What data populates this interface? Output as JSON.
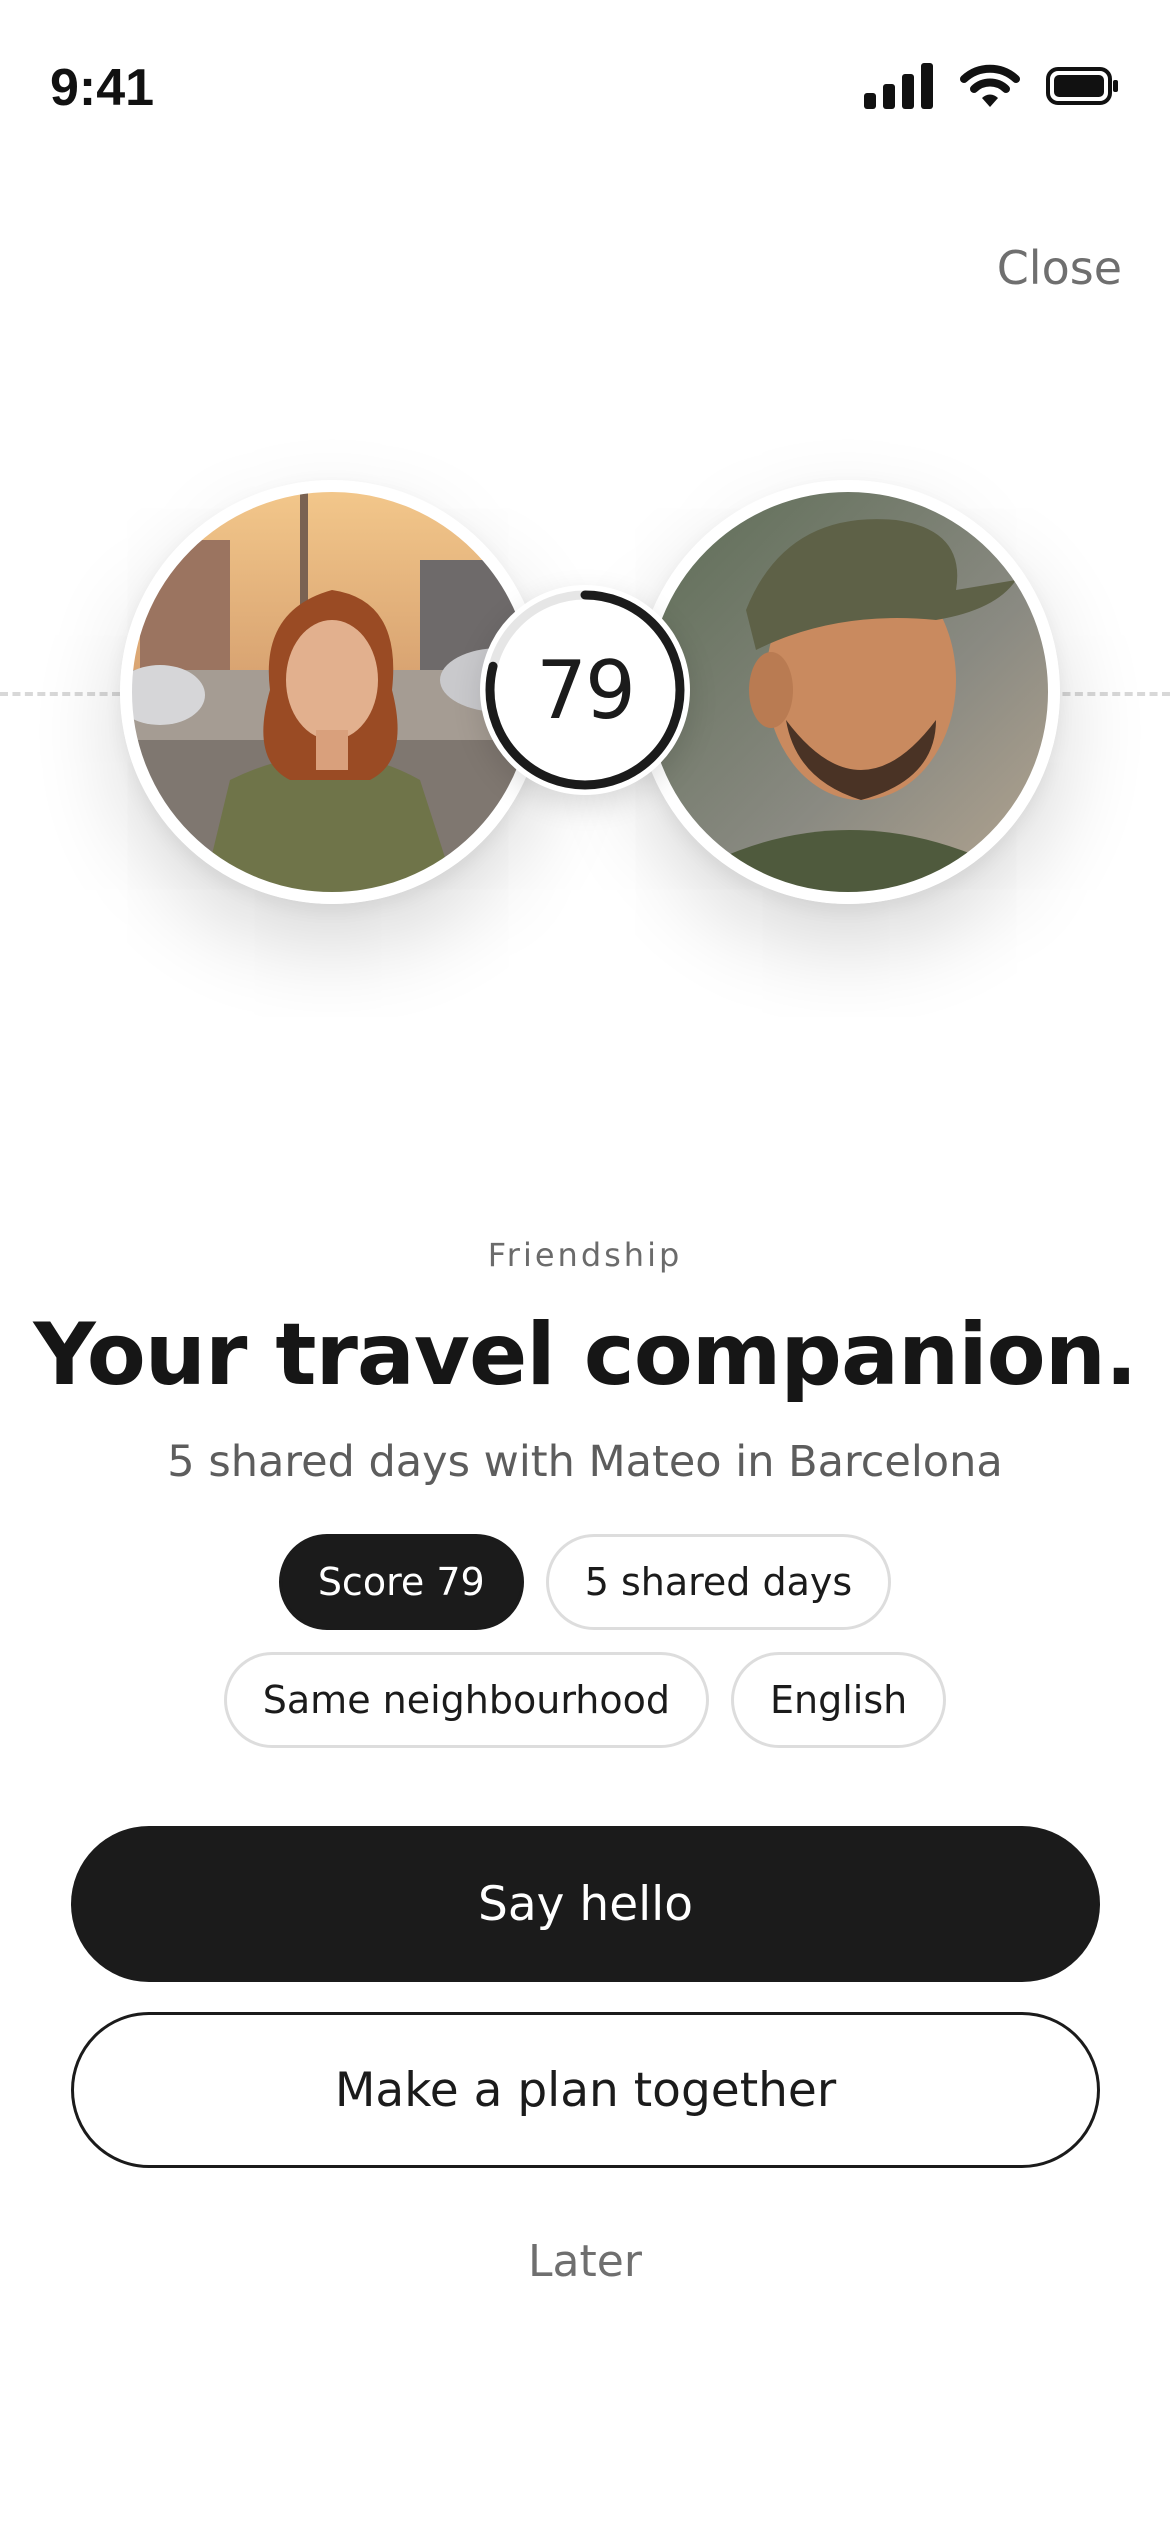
{
  "status_bar": {
    "time": "9:41",
    "icons": [
      "cellular-signal-icon",
      "wifi-icon",
      "battery-icon"
    ]
  },
  "header": {
    "close_label": "Close"
  },
  "match": {
    "score": "79",
    "score_progress": 0.79,
    "left_avatar": "woman-portrait-photo",
    "right_avatar": "man-in-cap-portrait-photo"
  },
  "content": {
    "eyebrow": "Friendship",
    "headline": "Your travel companion.",
    "subtitle": "5 shared days with Mateo in Barcelona"
  },
  "chips": [
    {
      "label": "Score 79",
      "selected": true
    },
    {
      "label": "5 shared days",
      "selected": false
    },
    {
      "label": "Same neighbourhood",
      "selected": false
    },
    {
      "label": "English",
      "selected": false
    }
  ],
  "actions": {
    "primary_label": "Say hello",
    "secondary_label": "Make a plan together",
    "tertiary_label": "Later"
  },
  "colors": {
    "text_primary": "#1b1b1b",
    "text_muted": "#6f6f6f",
    "chip_border": "#dddddd",
    "background": "#ffffff"
  }
}
